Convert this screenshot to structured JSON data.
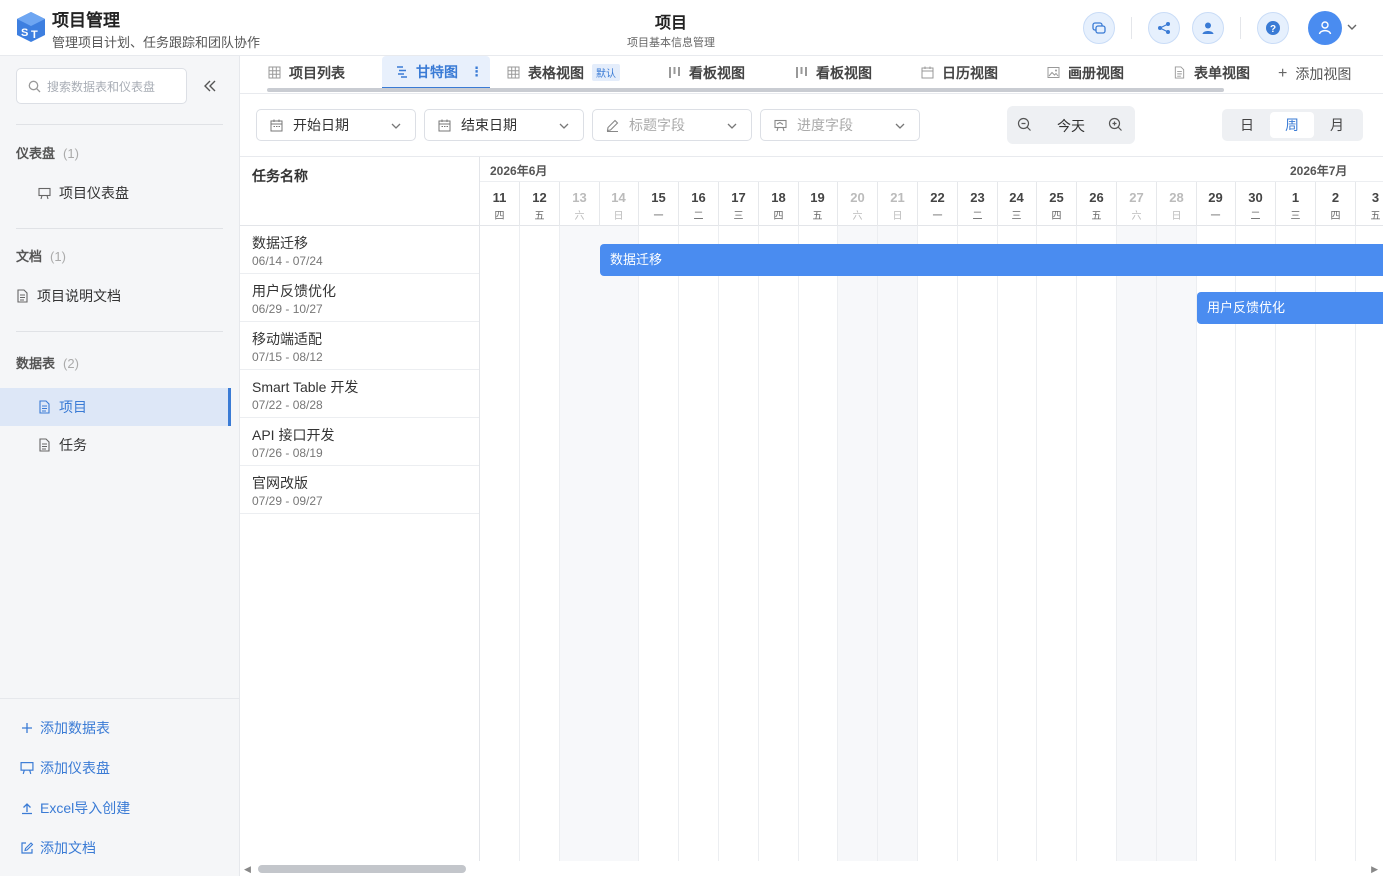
{
  "header": {
    "app_title": "项目管理",
    "app_subtitle": "管理项目计划、任务跟踪和团队协作",
    "page_title": "项目",
    "page_subtitle": "项目基本信息管理"
  },
  "sidebar": {
    "search_placeholder": "搜索数据表和仪表盘",
    "groups": [
      {
        "label": "仪表盘",
        "count": "(1)",
        "items": [
          "项目仪表盘"
        ]
      },
      {
        "label": "文档",
        "count": "(1)",
        "items": [
          "项目说明文档"
        ]
      },
      {
        "label": "数据表",
        "count": "(2)",
        "items": [
          "项目",
          "任务"
        ]
      }
    ],
    "active_item": "项目",
    "actions": [
      "添加数据表",
      "添加仪表盘",
      "Excel导入创建",
      "添加文档"
    ]
  },
  "tabs": {
    "items": [
      {
        "label": "项目列表",
        "icon": "grid-icon"
      },
      {
        "label": "甘特图",
        "icon": "gantt-icon",
        "active": true
      },
      {
        "label": "表格视图",
        "icon": "grid-icon",
        "badge": "默认"
      },
      {
        "label": "看板视图",
        "icon": "kanban-icon"
      },
      {
        "label": "看板视图",
        "icon": "kanban-icon"
      },
      {
        "label": "日历视图",
        "icon": "calendar-icon"
      },
      {
        "label": "画册视图",
        "icon": "image-icon"
      },
      {
        "label": "表单视图",
        "icon": "form-icon"
      }
    ],
    "add_view": "添加视图"
  },
  "toolbar": {
    "start_date": "开始日期",
    "end_date": "结束日期",
    "title_field": "标题字段",
    "progress_field": "进度字段",
    "today": "今天",
    "scales": [
      "日",
      "周",
      "月"
    ],
    "active_scale": "周"
  },
  "gantt": {
    "task_header": "任务名称",
    "months": [
      "2026年6月",
      "2026年7月"
    ],
    "days": [
      {
        "d": "11",
        "w": "四"
      },
      {
        "d": "12",
        "w": "五"
      },
      {
        "d": "13",
        "w": "六",
        "weekend": true
      },
      {
        "d": "14",
        "w": "日",
        "weekend": true
      },
      {
        "d": "15",
        "w": "一"
      },
      {
        "d": "16",
        "w": "二"
      },
      {
        "d": "17",
        "w": "三"
      },
      {
        "d": "18",
        "w": "四"
      },
      {
        "d": "19",
        "w": "五"
      },
      {
        "d": "20",
        "w": "六",
        "weekend": true
      },
      {
        "d": "21",
        "w": "日",
        "weekend": true
      },
      {
        "d": "22",
        "w": "一"
      },
      {
        "d": "23",
        "w": "二"
      },
      {
        "d": "24",
        "w": "三"
      },
      {
        "d": "25",
        "w": "四"
      },
      {
        "d": "26",
        "w": "五"
      },
      {
        "d": "27",
        "w": "六",
        "weekend": true
      },
      {
        "d": "28",
        "w": "日",
        "weekend": true
      },
      {
        "d": "29",
        "w": "一"
      },
      {
        "d": "30",
        "w": "二"
      },
      {
        "d": "1",
        "w": "三"
      },
      {
        "d": "2",
        "w": "四"
      },
      {
        "d": "3",
        "w": "五"
      }
    ],
    "tasks": [
      {
        "name": "数据迁移",
        "range": "06/14 - 07/24"
      },
      {
        "name": "用户反馈优化",
        "range": "06/29 - 10/27"
      },
      {
        "name": "移动端适配",
        "range": "07/15 - 08/12"
      },
      {
        "name": "Smart Table 开发",
        "range": "07/22 - 08/28"
      },
      {
        "name": "API 接口开发",
        "range": "07/26 - 08/19"
      },
      {
        "name": "官网改版",
        "range": "07/29 - 09/27"
      }
    ]
  },
  "colors": {
    "accent": "#3a7bd5",
    "bar": "#4a8cf0"
  }
}
